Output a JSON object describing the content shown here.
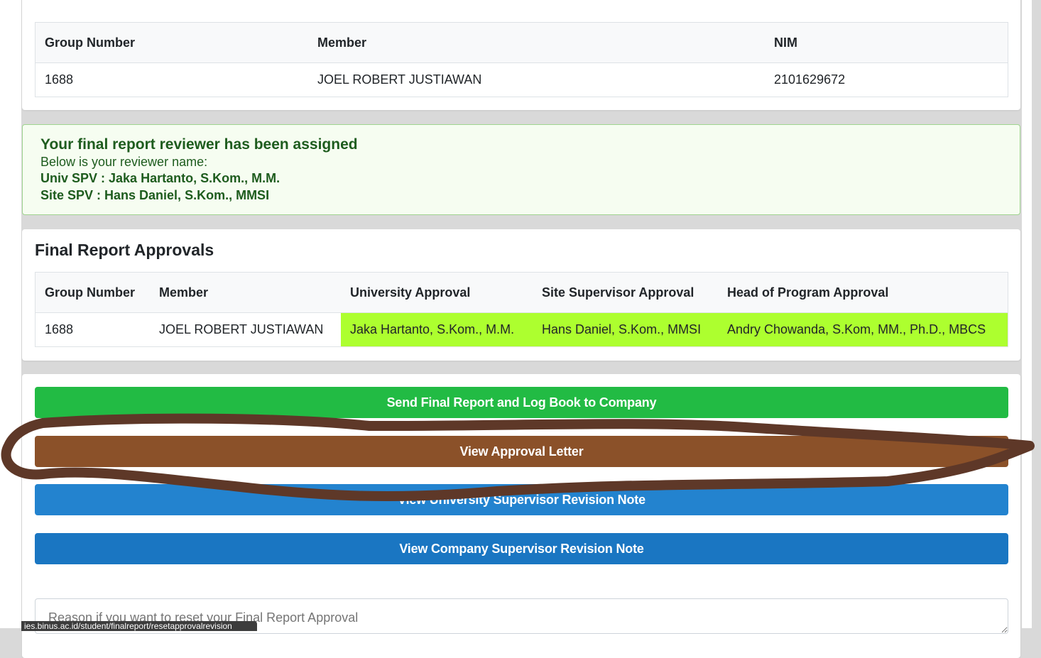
{
  "members_table": {
    "headers": [
      "Group Number",
      "Member",
      "NIM"
    ],
    "rows": [
      [
        "1688",
        "JOEL ROBERT JUSTIAWAN",
        "2101629672"
      ]
    ]
  },
  "reviewer_alert": {
    "title": "Your final report reviewer has been assigned",
    "subtitle": "Below is your reviewer name:",
    "univ_spv": "Univ SPV : Jaka Hartanto, S.Kom., M.M.",
    "site_spv": "Site SPV : Hans Daniel, S.Kom., MMSI"
  },
  "approvals": {
    "title": "Final Report Approvals",
    "headers": [
      "Group Number",
      "Member",
      "University Approval",
      "Site Supervisor Approval",
      "Head of Program Approval"
    ],
    "rows": [
      [
        "1688",
        "JOEL ROBERT JUSTIAWAN",
        "Jaka Hartanto, S.Kom., M.M.",
        "Hans Daniel, S.Kom., MMSI",
        "Andry Chowanda, S.Kom, MM., Ph.D., MBCS"
      ]
    ]
  },
  "buttons": {
    "send_final_report": "Send Final Report and Log Book to Company",
    "view_approval_letter": "View Approval Letter",
    "view_university_revision": "View University Supervisor Revision Note",
    "view_company_revision": "View Company Supervisor Revision Note"
  },
  "reset_reason": {
    "placeholder": "Reason if you want to reset your Final Report Approval"
  },
  "status_bar": {
    "url": "ies.binus.ac.id/student/finalreport/resetapprovalrevision"
  },
  "colors": {
    "primary_blue": "#2383cf",
    "danger_red": "#ff0000",
    "success_green": "#22bb44",
    "brown": "#8b5129",
    "approved_bg": "#adff2f",
    "annotation_stroke": "#5e3828"
  }
}
